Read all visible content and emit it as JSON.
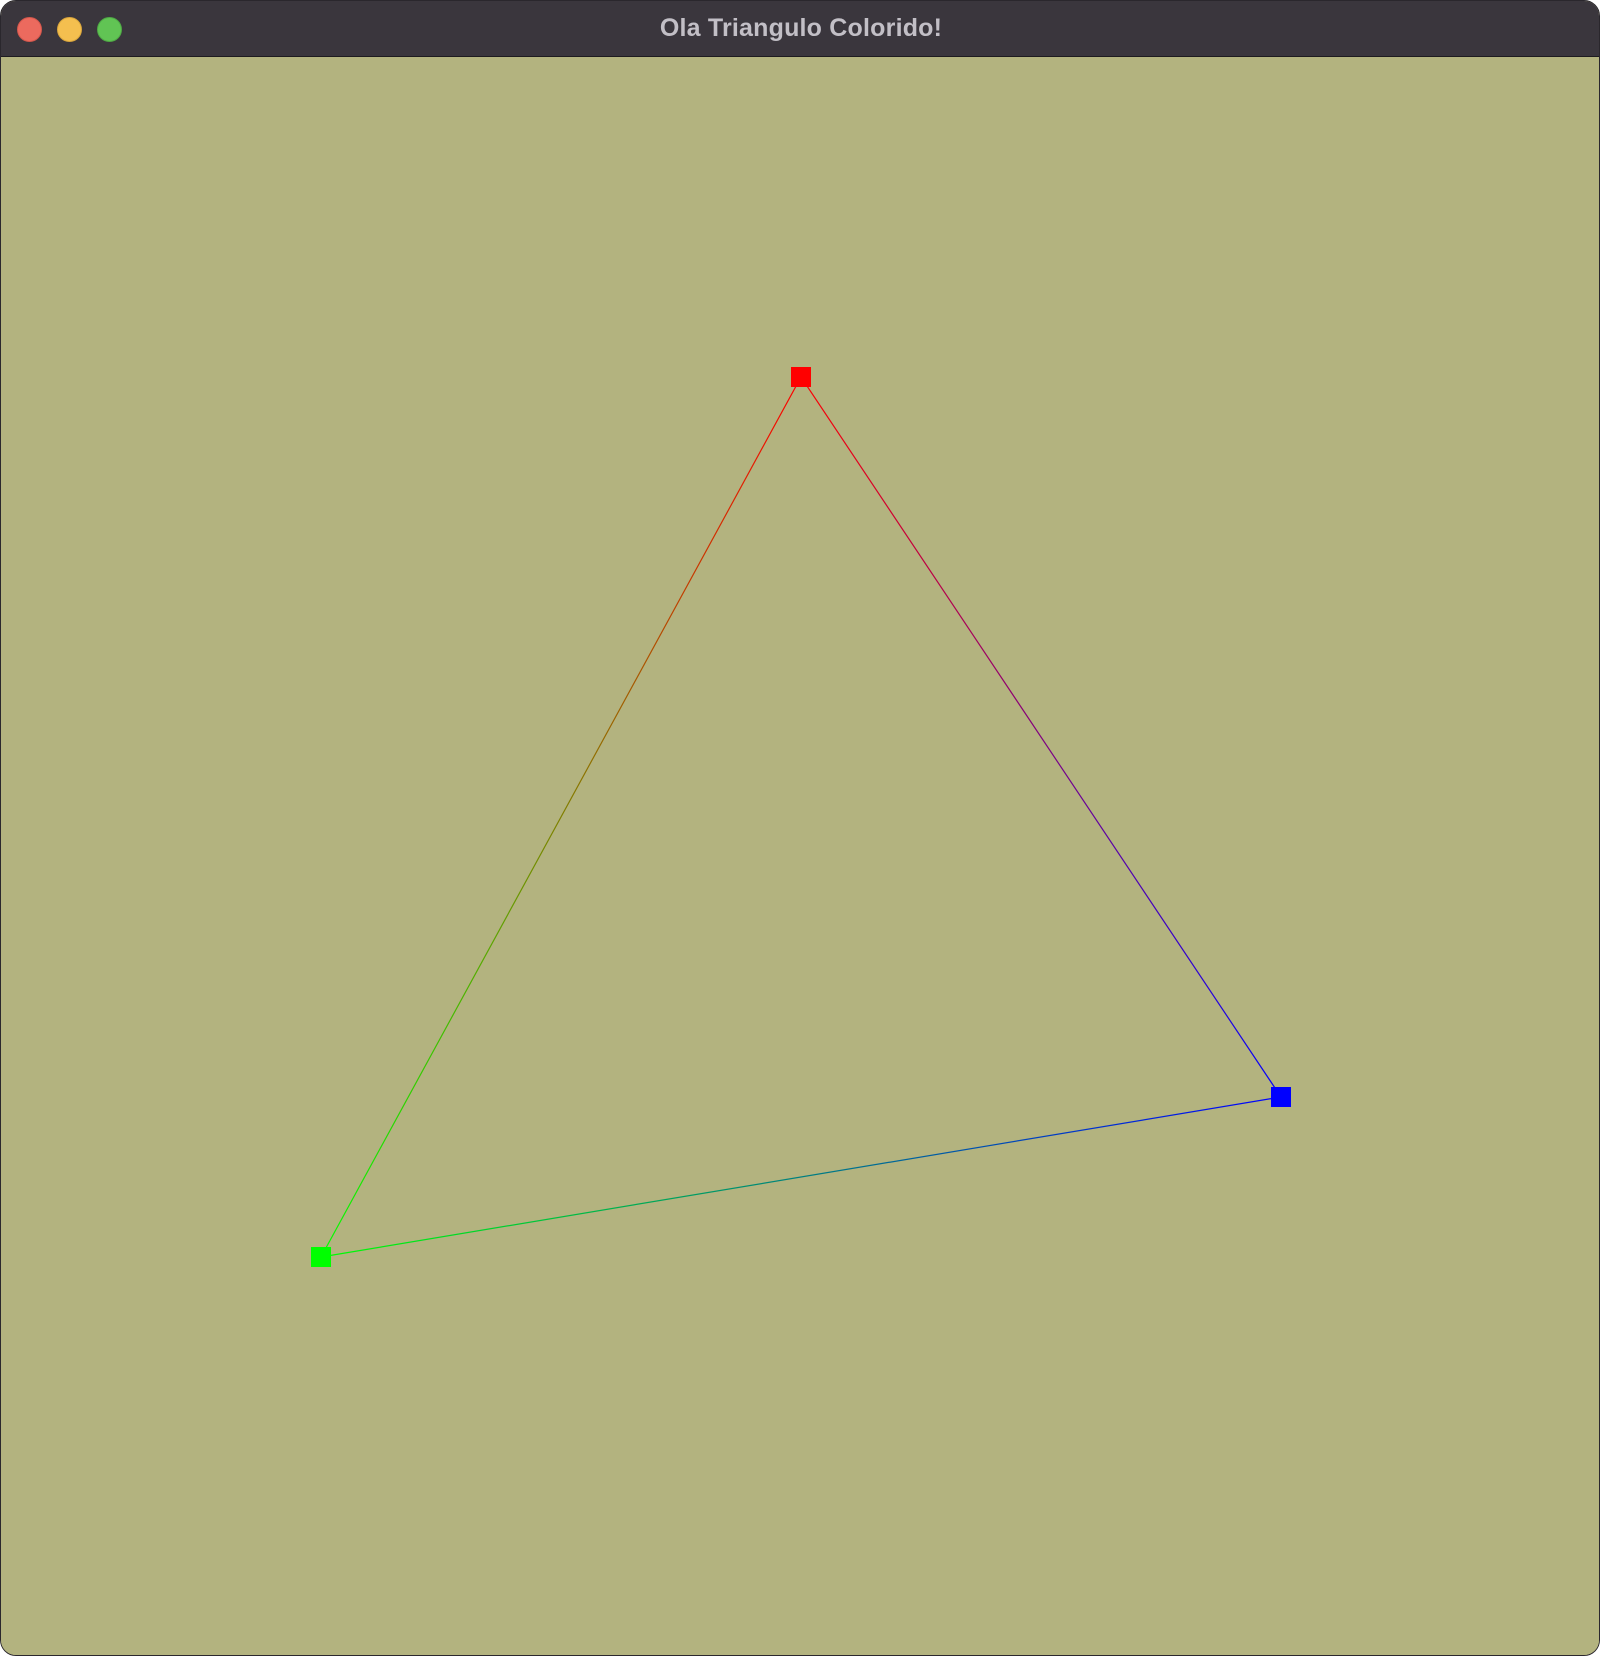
{
  "window": {
    "title": "Ola Triangulo Colorido!",
    "background_color": "#b3b37f",
    "titlebar_color": "#3a363d"
  },
  "traffic_lights": [
    {
      "name": "close",
      "color": "#ec6a5e"
    },
    {
      "name": "minimize",
      "color": "#f4bf4f"
    },
    {
      "name": "zoom",
      "color": "#61c454"
    }
  ],
  "triangle": {
    "vertices": [
      {
        "name": "top",
        "color": "#ff0000"
      },
      {
        "name": "bottom-left",
        "color": "#00ff00"
      },
      {
        "name": "right",
        "color": "#0000ff"
      }
    ]
  }
}
